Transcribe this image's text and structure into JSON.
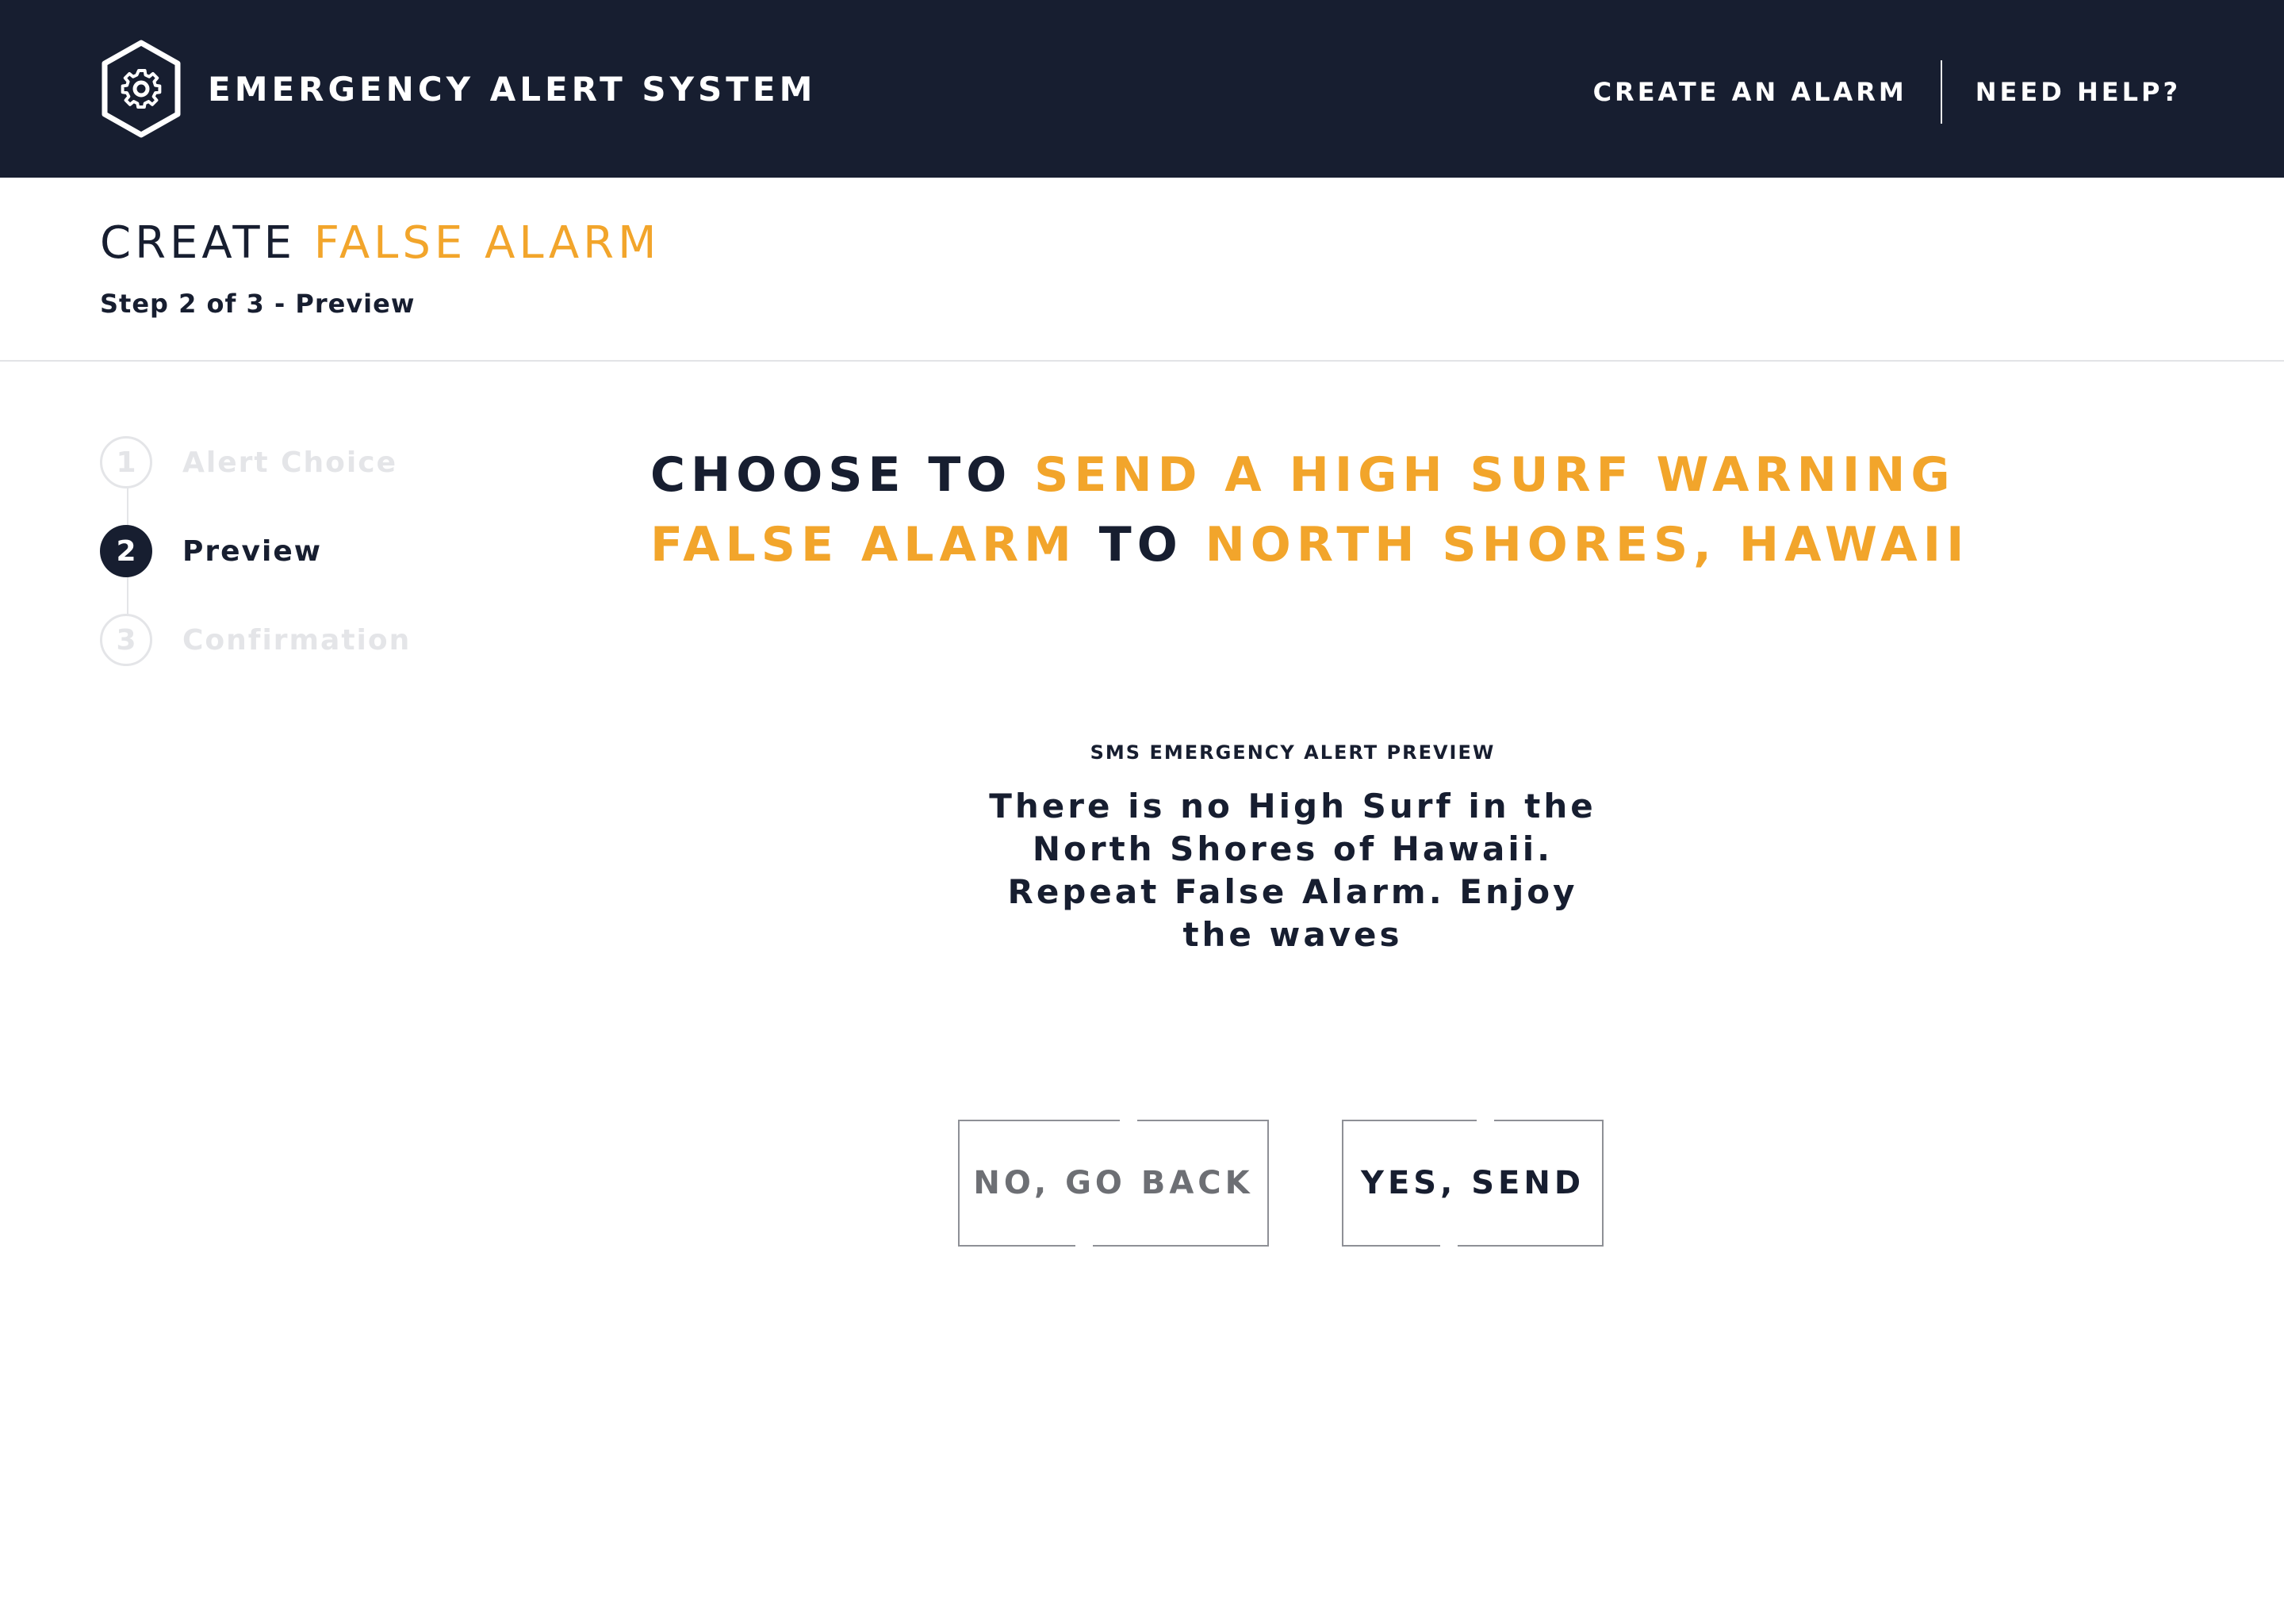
{
  "header": {
    "app_title": "EMERGENCY ALERT SYSTEM",
    "logo_icon": "shield-gear-icon",
    "nav": {
      "create_alarm": "CREATE AN ALARM",
      "need_help": "NEED HELP?"
    }
  },
  "page": {
    "title_prefix": "CREATE",
    "title_accent": "FALSE ALARM",
    "step_caption": "Step 2 of 3 - Preview"
  },
  "stepper": {
    "steps": [
      {
        "number": "1",
        "label": "Alert Choice",
        "state": "inactive"
      },
      {
        "number": "2",
        "label": "Preview",
        "state": "active"
      },
      {
        "number": "3",
        "label": "Confirmation",
        "state": "inactive"
      }
    ]
  },
  "headline": {
    "part1": "CHOOSE TO",
    "part2": "SEND A HIGH SURF WARNING",
    "part3": "FALSE ALARM",
    "part4": "TO",
    "part5": "NORTH SHORES, HAWAII"
  },
  "sms": {
    "label": "SMS EMERGENCY ALERT PREVIEW",
    "lines": [
      "There is no High Surf in the",
      "North Shores of Hawaii.",
      "Repeat False Alarm. Enjoy",
      "the waves"
    ]
  },
  "actions": {
    "back_label": "NO, GO BACK",
    "send_label": "YES, SEND"
  },
  "colors": {
    "navy": "#171e30",
    "accent": "#f2a52b",
    "inactive": "#e4e5e8",
    "muted_button_text": "#6d6f74"
  }
}
